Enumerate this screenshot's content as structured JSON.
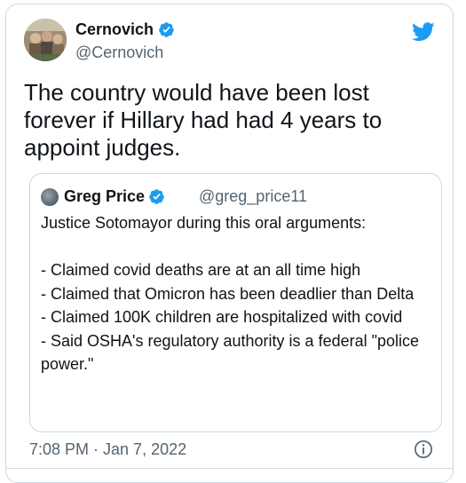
{
  "tweet": {
    "author": {
      "display_name": "Cernovich",
      "handle": "@Cernovich",
      "verified_icon": "verified-badge-icon"
    },
    "text": "The country would have been lost forever if Hillary had had 4 years to appoint judges.",
    "timestamp": "7:08 PM · Jan 7, 2022",
    "brand_color": "#1d9bf0"
  },
  "quoted_tweet": {
    "author": {
      "display_name": "Greg Price",
      "handle": "@greg_price11",
      "verified_icon": "verified-badge-icon"
    },
    "text": "Justice Sotomayor during this oral arguments:\n\n- Claimed covid deaths are at an all time high\n- Claimed that Omicron has been deadlier than Delta\n- Claimed 100K children are hospitalized with covid\n- Said OSHA's regulatory authority is a federal \"police power.\""
  }
}
